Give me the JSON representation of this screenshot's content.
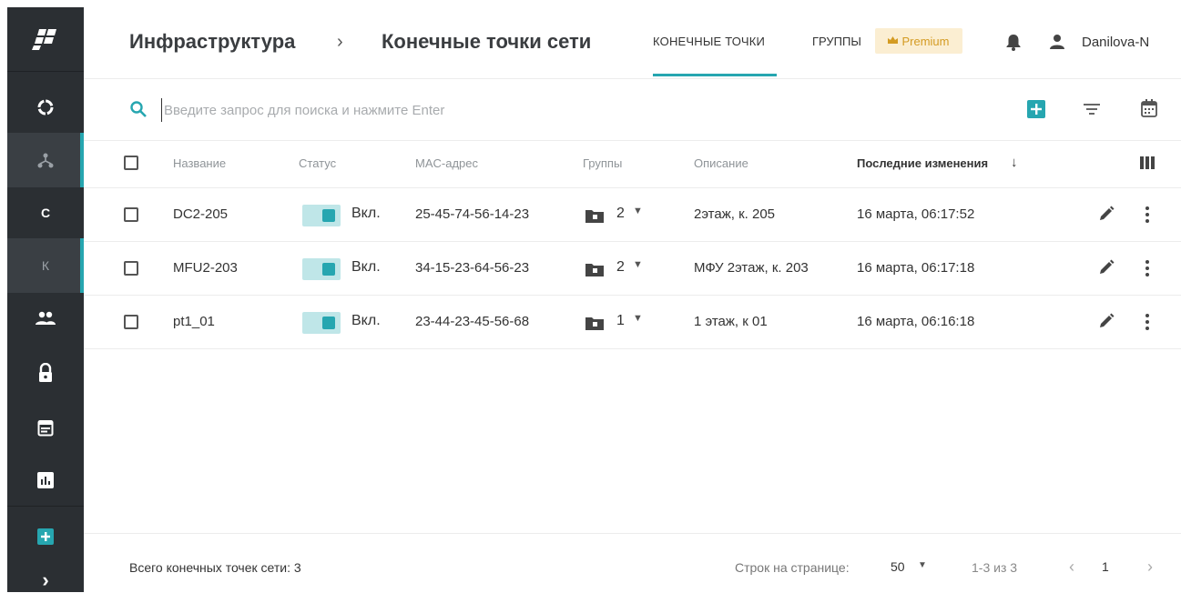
{
  "sidebar": {
    "items": [
      {
        "name": "logo-icon"
      },
      {
        "name": "circle-icon"
      },
      {
        "name": "network-icon",
        "active": true
      },
      {
        "letter": "C"
      },
      {
        "letter": "К",
        "active": true
      },
      {
        "name": "users-icon"
      },
      {
        "name": "lock-icon"
      },
      {
        "name": "calendar-icon"
      },
      {
        "name": "chart-icon"
      },
      {
        "name": "add-icon"
      },
      {
        "name": "chevron-right-icon",
        "glyph": "›"
      }
    ]
  },
  "header": {
    "breadcrumb_root": "Инфраструктура",
    "breadcrumb_sep": "›",
    "breadcrumb_current": "Конечные точки сети",
    "tabs": [
      {
        "label": "КОНЕЧНЫЕ ТОЧКИ",
        "active": true
      },
      {
        "label": "ГРУППЫ",
        "active": false
      }
    ],
    "premium_label": "Premium",
    "username": "Danilova-N"
  },
  "search": {
    "placeholder": "Введите запрос для поиска и нажмите Enter",
    "value": ""
  },
  "table": {
    "columns": [
      "Название",
      "Статус",
      "MAC-адрес",
      "Группы",
      "Описание",
      "Последние изменения"
    ],
    "sort_indicator": "↓",
    "rows": [
      {
        "name": "DC2-205",
        "status": "Вкл.",
        "mac": "25-45-74-56-14-23",
        "groups": "2",
        "description": "2этаж, к. 205",
        "modified": "16 марта, 06:17:52"
      },
      {
        "name": "MFU2-203",
        "status": "Вкл.",
        "mac": "34-15-23-64-56-23",
        "groups": "2",
        "description": "МФУ 2этаж, к. 203",
        "modified": "16 марта, 06:17:18"
      },
      {
        "name": "pt1_01",
        "status": "Вкл.",
        "mac": "23-44-23-45-56-68",
        "groups": "1",
        "description": "1 этаж, к 01",
        "modified": "16 марта, 06:16:18"
      }
    ]
  },
  "footer": {
    "total": "Всего конечных точек сети: 3",
    "rows_per_page_label": "Строк на странице:",
    "rows_per_page_value": "50",
    "range": "1-3 из 3",
    "page": "1"
  },
  "colors": {
    "accent": "#26a6b0",
    "sidebar_bg": "#2b2f33",
    "premium_bg": "#fbeed2",
    "premium_text": "#d49b22"
  }
}
